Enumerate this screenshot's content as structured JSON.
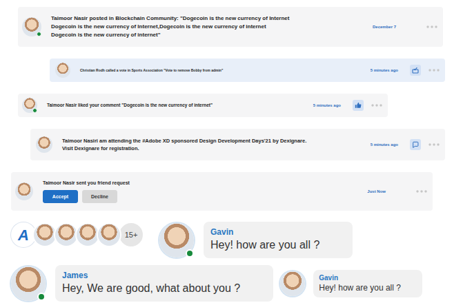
{
  "notifications": [
    {
      "kind": "post",
      "online": true,
      "lines": [
        "Taimoor Nasir posted in Blockchain Community: \"Dogecoin is the new currency of Internet",
        "Dogecoin is the new currency of Internet,Dogecoin is the new currency of internet",
        "Dogecoin is the new currency of internet\""
      ],
      "time": "December 7"
    },
    {
      "kind": "vote",
      "online": false,
      "lines": [
        "Christian Rodh called a vote  in Sports Association \"Vote to remove Bobby from admin\""
      ],
      "time": "5 minutes ago"
    },
    {
      "kind": "like",
      "online": true,
      "lines": [
        "Taimoor Nasir liked your comment \"Dogecoin is the new currency of internet\""
      ],
      "time": "5 minutes ago"
    },
    {
      "kind": "event",
      "online": false,
      "lines": [
        "Taimoor Nasiri am attending the #Adobe XD sponsored Design Development Days'21 by Dexignare.",
        "Visit Dexignare for registration."
      ],
      "time": "5 minutes ago"
    },
    {
      "kind": "friend-request",
      "online": false,
      "lines": [
        "Taimoor Nasir sent you friend request"
      ],
      "time": "Just Now",
      "buttons": [
        "Accept",
        "Decline"
      ]
    }
  ],
  "group": {
    "logo": "A",
    "members": [
      {
        "online": false
      },
      {
        "online": false
      },
      {
        "online": false
      },
      {
        "online": false
      }
    ],
    "more": "15+"
  },
  "chats": [
    {
      "kind": "large",
      "name": "Gavin",
      "message": "Hey! how are you all ?",
      "online": true
    },
    {
      "kind": "large",
      "name": "James",
      "message": "Hey, We are good, what about you ?",
      "online": true
    },
    {
      "kind": "compact",
      "name": "Gavin",
      "message": "Hey! how are you all ?",
      "online": false
    }
  ]
}
